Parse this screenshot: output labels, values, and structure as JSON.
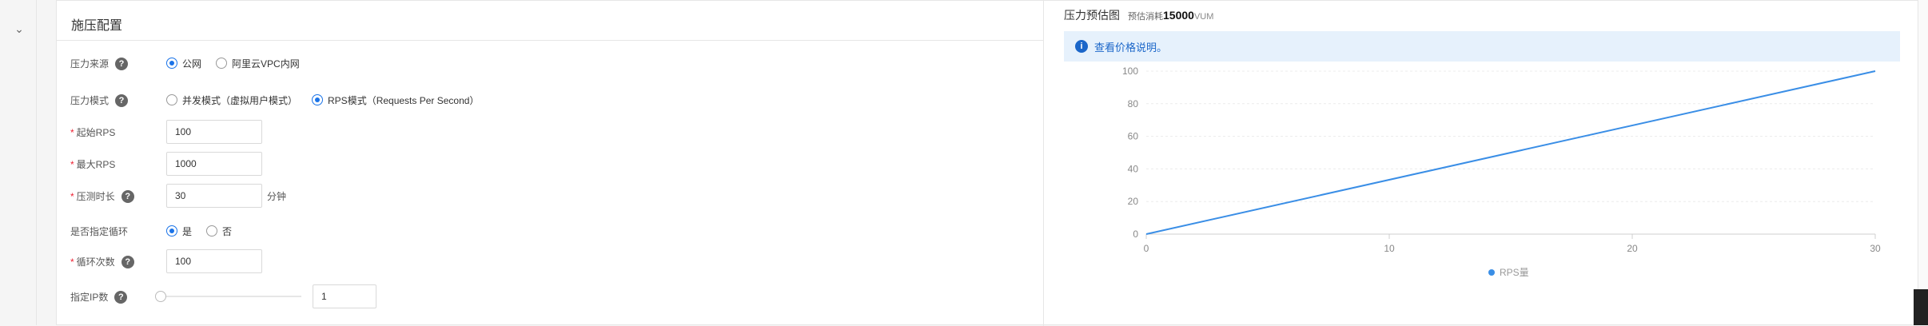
{
  "config": {
    "title": "施压配置",
    "pressure_source": {
      "label": "压力来源",
      "options": [
        "公网",
        "阿里云VPC内网"
      ],
      "selected": 0
    },
    "pressure_mode": {
      "label": "压力模式",
      "options": [
        "并发模式（虚拟用户模式）",
        "RPS模式（Requests Per Second）"
      ],
      "selected": 1
    },
    "start_rps": {
      "label": "起始RPS",
      "value": "100"
    },
    "max_rps": {
      "label": "最大RPS",
      "value": "1000"
    },
    "duration": {
      "label": "压测时长",
      "value": "30",
      "unit": "分钟"
    },
    "loop": {
      "label": "是否指定循环",
      "options": [
        "是",
        "否"
      ],
      "selected": 0
    },
    "loop_count": {
      "label": "循环次数",
      "value": "100"
    },
    "ip_count": {
      "label": "指定IP数",
      "value": "1",
      "slider_fraction": 0
    }
  },
  "chart_header": {
    "title": "压力预估图",
    "consumption_label": "预估消耗",
    "consumption_value": "15000",
    "consumption_unit": "VUM"
  },
  "info_banner": {
    "icon": "info-icon",
    "text": "查看价格说明。"
  },
  "colors": {
    "accent": "#1a73e8",
    "line": "#3a8ee6",
    "banner_bg": "#e6f1fc"
  },
  "chart_data": {
    "type": "line",
    "x": [
      0,
      30
    ],
    "series": [
      {
        "name": "RPS量",
        "values": [
          0,
          100
        ]
      }
    ],
    "xticks": [
      "0",
      "10",
      "20",
      "30"
    ],
    "yticks": [
      "0",
      "20",
      "40",
      "60",
      "80",
      "100"
    ],
    "xlim": [
      0,
      30
    ],
    "ylim": [
      0,
      100
    ],
    "grid": true,
    "legend": "bottom-center"
  }
}
